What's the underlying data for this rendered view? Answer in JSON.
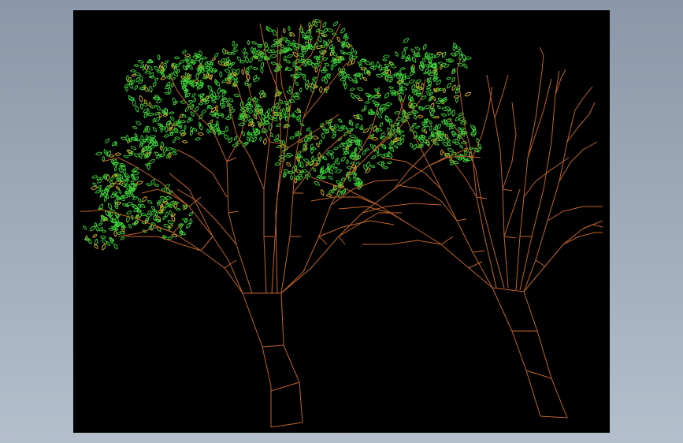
{
  "window": {
    "frame_color": "#a1adbb"
  },
  "viewport": {
    "background": "#000000"
  },
  "drawing": {
    "subject": "two-tree-wireframe",
    "trunk_color": "#c0632a",
    "foliage_color": "#3fd13a",
    "foliage_secondary_color": "#d3b22a",
    "trees": [
      {
        "id": "left-tree-with-foliage",
        "has_foliage": true
      },
      {
        "id": "right-tree-bare",
        "has_foliage": false
      }
    ]
  }
}
